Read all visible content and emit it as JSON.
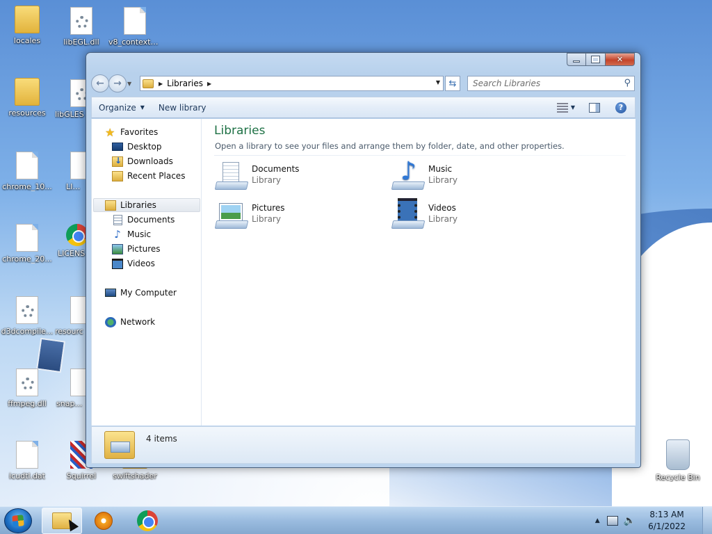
{
  "desktop": {
    "icons": [
      {
        "label": "locales",
        "kind": "folder"
      },
      {
        "label": "libEGL.dll",
        "kind": "dll"
      },
      {
        "label": "v8_context_...",
        "kind": "file"
      },
      {
        "label": "resources",
        "kind": "folder"
      },
      {
        "label": "libGLES",
        "kind": "dll"
      },
      {
        "label": "chrome_10...",
        "kind": "file"
      },
      {
        "label": "LICEN",
        "kind": "file"
      },
      {
        "label": "chrome_20...",
        "kind": "file"
      },
      {
        "label": "LICENS",
        "kind": "chrome"
      },
      {
        "label": "d3dcompile...",
        "kind": "dll"
      },
      {
        "label": "resourc",
        "kind": "file"
      },
      {
        "label": "ffmpeg.dll",
        "kind": "dll"
      },
      {
        "label": "snapsho",
        "kind": "file"
      },
      {
        "label": "icudtl.dat",
        "kind": "file"
      },
      {
        "label": "Squirrel",
        "kind": "squirrel"
      },
      {
        "label": "swiftshader",
        "kind": "folder"
      },
      {
        "label": "Recycle Bin",
        "kind": "recycle"
      }
    ]
  },
  "window": {
    "address": {
      "segments": [
        "Libraries"
      ]
    },
    "search": {
      "placeholder": "Search Libraries"
    },
    "toolbar": {
      "organize": "Organize",
      "new_library": "New library"
    },
    "nav": {
      "favorites": "Favorites",
      "desktop": "Desktop",
      "downloads": "Downloads",
      "recent_places": "Recent Places",
      "libraries": "Libraries",
      "documents": "Documents",
      "music": "Music",
      "pictures": "Pictures",
      "videos": "Videos",
      "my_computer": "My Computer",
      "network": "Network"
    },
    "content": {
      "title": "Libraries",
      "subtitle": "Open a library to see your files and arrange them by folder, date, and other properties.",
      "libraries": [
        {
          "name": "Documents",
          "type": "Library"
        },
        {
          "name": "Music",
          "type": "Library"
        },
        {
          "name": "Pictures",
          "type": "Library"
        },
        {
          "name": "Videos",
          "type": "Library"
        }
      ]
    },
    "details": {
      "count": "4 items"
    }
  },
  "taskbar": {
    "clock": {
      "time": "8:13 AM",
      "date": "6/1/2022"
    }
  }
}
